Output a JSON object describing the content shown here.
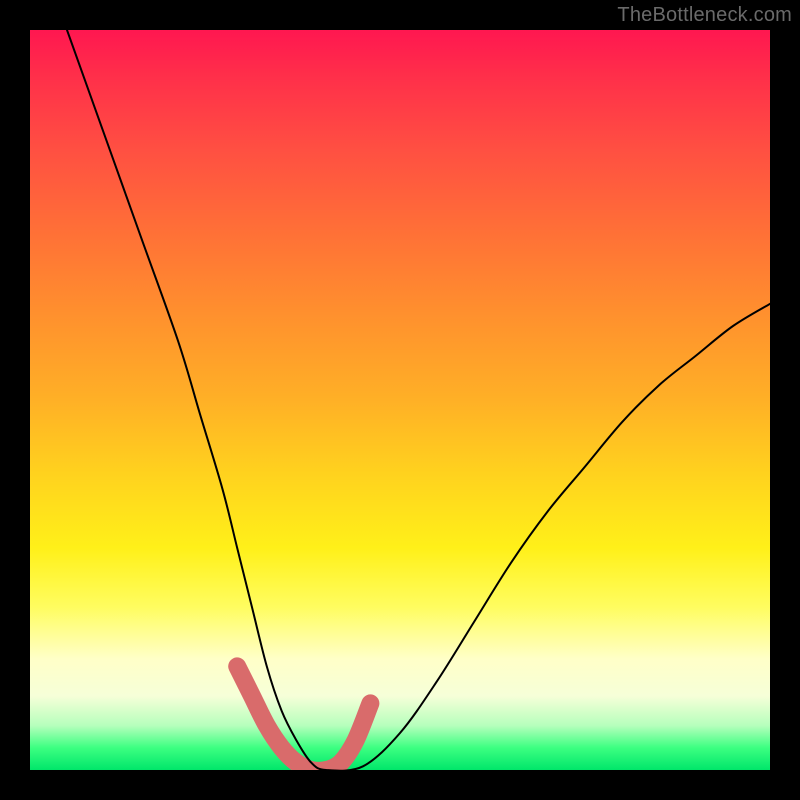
{
  "watermark": "TheBottleneck.com",
  "chart_data": {
    "type": "line",
    "title": "",
    "xlabel": "",
    "ylabel": "",
    "ylim": [
      0,
      100
    ],
    "xlim": [
      0,
      100
    ],
    "series": [
      {
        "name": "curve",
        "x": [
          5,
          10,
          15,
          20,
          23,
          26,
          28,
          30,
          32,
          34,
          36,
          38,
          40,
          45,
          50,
          55,
          60,
          65,
          70,
          75,
          80,
          85,
          90,
          95,
          100
        ],
        "values": [
          100,
          86,
          72,
          58,
          48,
          38,
          30,
          22,
          14,
          8,
          4,
          1,
          0,
          0.5,
          5,
          12,
          20,
          28,
          35,
          41,
          47,
          52,
          56,
          60,
          63
        ]
      },
      {
        "name": "highlight_band",
        "x": [
          28,
          30,
          32,
          34,
          36,
          38,
          40,
          42,
          44,
          46
        ],
        "values": [
          14,
          10,
          6,
          3,
          1,
          0,
          0,
          1,
          4,
          9
        ]
      }
    ]
  }
}
